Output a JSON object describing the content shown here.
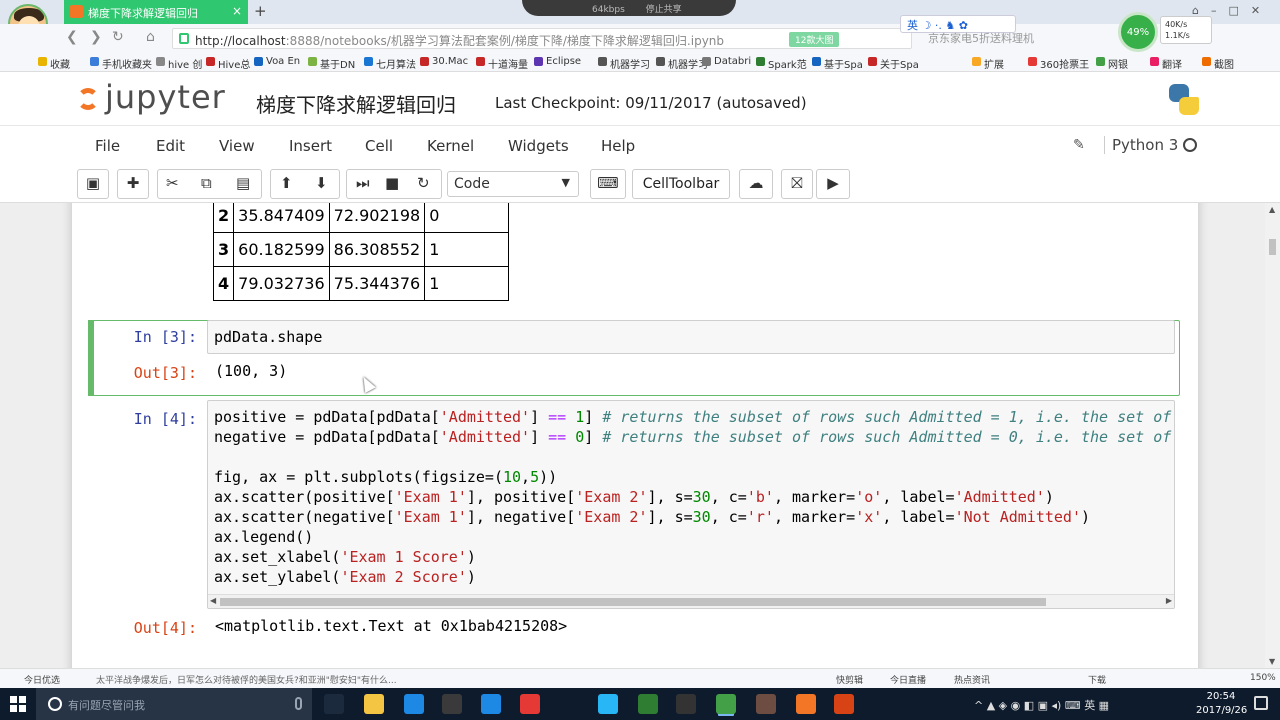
{
  "browser": {
    "tab_title": "梯度下降求解逻辑回归",
    "url_host": "http://localhost",
    "url_rest": ":8888/notebooks/机器学习算法配套案例/梯度下降/梯度下降求解逻辑回归.ipynb",
    "url_badge": "12款大图",
    "search_hint": "京东家电5折送料理机",
    "camera_overlay": [
      "64kbps",
      "停止共享"
    ],
    "ime_label": "英",
    "net_percent": "49%",
    "net_up": "40K/s",
    "net_down": "1.1K/s",
    "bookmarks": [
      {
        "label": "收藏",
        "color": "#e8b400"
      },
      {
        "label": "手机收藏夹",
        "color": "#3b7dd8"
      },
      {
        "label": "hive 创",
        "color": "#888888"
      },
      {
        "label": "Hive总",
        "color": "#c62828"
      },
      {
        "label": "Voa En",
        "color": "#1565c0"
      },
      {
        "label": "基于DN",
        "color": "#7cb342"
      },
      {
        "label": "七月算法",
        "color": "#1976d2"
      },
      {
        "label": "30.Mac",
        "color": "#c62828"
      },
      {
        "label": "十道海量",
        "color": "#c62828"
      },
      {
        "label": "Eclipse",
        "color": "#5e35b1"
      },
      {
        "label": "机器学习",
        "color": "#555555"
      },
      {
        "label": "机器学习",
        "color": "#555555"
      },
      {
        "label": "Databri",
        "color": "#777777"
      },
      {
        "label": "Spark范",
        "color": "#2e7d32"
      },
      {
        "label": "基于Spa",
        "color": "#1565c0"
      },
      {
        "label": "关于Spa",
        "color": "#c62828"
      },
      {
        "label": "扩展",
        "color": "#f9a825"
      },
      {
        "label": "360抢票王",
        "color": "#e53935"
      },
      {
        "label": "网银",
        "color": "#43a047"
      },
      {
        "label": "翻译",
        "color": "#e91e63"
      },
      {
        "label": "截图",
        "color": "#ef6c00"
      }
    ]
  },
  "jupyter": {
    "logo_text": "jupyter",
    "notebook_name": "梯度下降求解逻辑回归",
    "checkpoint": "Last Checkpoint: 09/11/2017 (autosaved)",
    "menu": [
      "File",
      "Edit",
      "View",
      "Insert",
      "Cell",
      "Kernel",
      "Widgets",
      "Help"
    ],
    "kernel_name": "Python 3",
    "cell_type": "Code",
    "celltoolbar_label": "CellToolbar"
  },
  "dataframe_rows": [
    {
      "index": "2",
      "exam1": "35.847409",
      "exam2": "72.902198",
      "admitted": "0"
    },
    {
      "index": "3",
      "exam1": "60.182599",
      "exam2": "86.308552",
      "admitted": "1"
    },
    {
      "index": "4",
      "exam1": "79.032736",
      "exam2": "75.344376",
      "admitted": "1"
    }
  ],
  "cells": {
    "cell3": {
      "in_prompt": "In [3]:",
      "code": "pdData.shape",
      "out_prompt": "Out[3]:",
      "output": "(100, 3)"
    },
    "cell4": {
      "in_prompt": "In [4]:",
      "out_prompt": "Out[4]:",
      "output": "<matplotlib.text.Text at 0x1bab4215208>"
    }
  },
  "status_bar": {
    "left": "今日优选",
    "news": "太平洋战争爆发后，日军怎么对待被俘的美国女兵?和亚洲\"慰安妇\"有什么...",
    "items": [
      "快剪辑",
      "今日直播",
      "热点资讯",
      "下载",
      "150%"
    ]
  },
  "taskbar": {
    "search_placeholder": "有问题尽管问我",
    "ime": "英",
    "time": "20:54",
    "date": "2017/9/26",
    "apps": [
      {
        "name": "task-view",
        "color": "#1c2a3d"
      },
      {
        "name": "file-explorer",
        "color": "#f4c542"
      },
      {
        "name": "edge",
        "color": "#1e88e5"
      },
      {
        "name": "store",
        "color": "#3a3a3a"
      },
      {
        "name": "app-blue",
        "color": "#1e88e5"
      },
      {
        "name": "chrome",
        "color": "#e53935"
      },
      {
        "name": "ie",
        "color": "#29b6f6"
      },
      {
        "name": "excel-green",
        "color": "#2e7d32"
      },
      {
        "name": "jupyter-edit",
        "color": "#333333"
      },
      {
        "name": "360-browser",
        "color": "#43a047"
      },
      {
        "name": "paint",
        "color": "#6d4c41"
      },
      {
        "name": "anaconda",
        "color": "#f37626"
      },
      {
        "name": "powerpoint",
        "color": "#d84315"
      }
    ]
  }
}
